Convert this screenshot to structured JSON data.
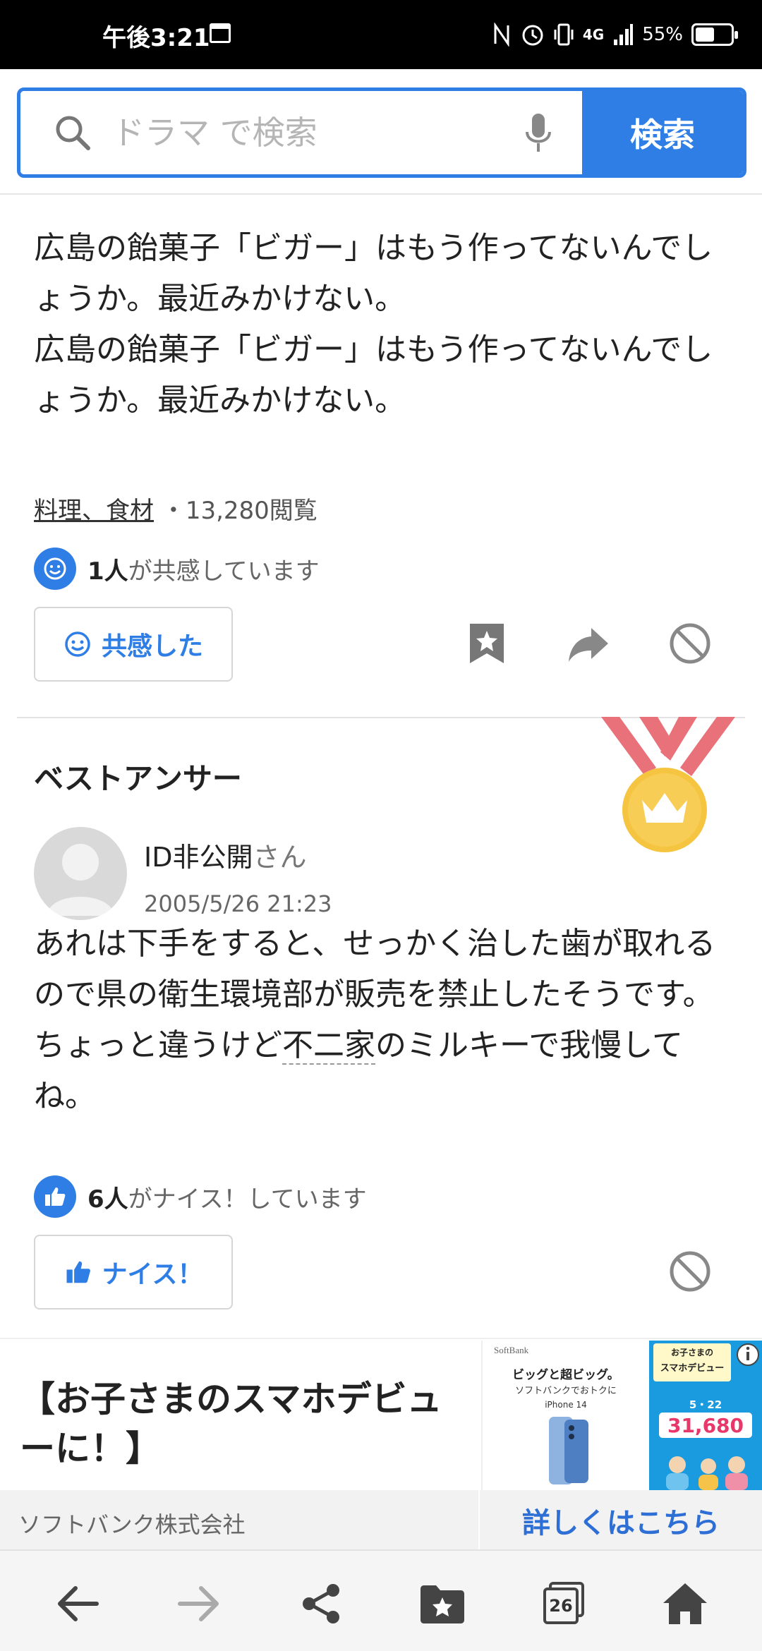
{
  "status_bar": {
    "time": "午後3:21",
    "network": "4G",
    "battery": "55%",
    "battery_level": 0.55
  },
  "search": {
    "placeholder": "ドラマ で検索",
    "button_label": "検索"
  },
  "question": {
    "text": "広島の飴菓子「ビガー」はもう作ってないんでしょうか。最近みかけない。\n広島の飴菓子「ビガー」はもう作ってないんでしょうか。最近みかけない。",
    "category": "料理、食材",
    "separator": "・",
    "views": "13,280閲覧",
    "empathy_count": "1人",
    "empathy_suffix": "が共感しています",
    "empathy_button": "共感した"
  },
  "best_answer": {
    "title": "ベストアンサー",
    "user_name": "ID非公開",
    "user_suffix": "さん",
    "date": "2005/5/26 21:23",
    "text_part1": "あれは下手をすると、せっかく治した歯が取れるので県の衛生環境部が販売を禁止したそうです。ちょっと違うけど",
    "text_link": "不二家",
    "text_part2": "のミルキーで我慢してね。",
    "nice_count": "6人",
    "nice_suffix": "がナイス！しています",
    "nice_button": "ナイス！"
  },
  "ad": {
    "title": "【お子さまのスマホデビューに！】",
    "company": "ソフトバンク株式会社",
    "link_label": "詳しくはこちら",
    "img1_brand": "SoftBank",
    "img1_line1": "ビッグと超ビッグ。",
    "img1_line2": "ソフトバンクでおトクに",
    "img1_product": "iPhone 14",
    "img2_line1": "お子さまの",
    "img2_line2": "スマホデビュー",
    "img2_date": "5・22",
    "img2_price": "31,680"
  },
  "bottom_nav": {
    "tabs_count": "26"
  },
  "colors": {
    "accent": "#2e7ee6",
    "link_blue": "#2e6fd6",
    "medal_gold": "#f5c542",
    "ribbon": "#e8717a"
  }
}
